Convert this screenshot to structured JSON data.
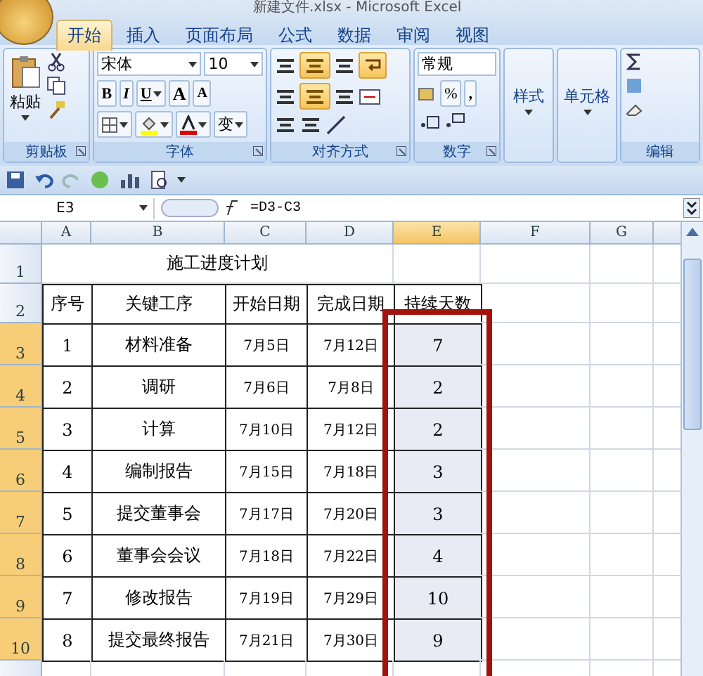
{
  "window": {
    "title": "新建文件.xlsx - Microsoft Excel"
  },
  "tabs": [
    {
      "label": "开始",
      "selected": true
    },
    {
      "label": "插入",
      "selected": false
    },
    {
      "label": "页面布局",
      "selected": false
    },
    {
      "label": "公式",
      "selected": false
    },
    {
      "label": "数据",
      "selected": false
    },
    {
      "label": "审阅",
      "selected": false
    },
    {
      "label": "视图",
      "selected": false
    }
  ],
  "ribbon": {
    "clipboard": {
      "paste": "粘贴",
      "label": "剪贴板"
    },
    "font": {
      "name": "宋体",
      "size": "10",
      "bold": "B",
      "italic": "I",
      "underline": "U",
      "grow": "A",
      "shrink": "A",
      "phonetic": "变",
      "label": "字体"
    },
    "alignment": {
      "label": "对齐方式"
    },
    "number": {
      "format": "常规",
      "percent": "%",
      "comma": ",",
      "label": "数字"
    },
    "styles": {
      "label": "样式"
    },
    "cells": {
      "label": "单元格"
    },
    "editing": {
      "label": "编辑"
    }
  },
  "formula_bar": {
    "name_box": "E3",
    "formula": "=D3-C3"
  },
  "sheet": {
    "columns": [
      {
        "label": "A",
        "selected": false
      },
      {
        "label": "B",
        "selected": false
      },
      {
        "label": "C",
        "selected": false
      },
      {
        "label": "D",
        "selected": false
      },
      {
        "label": "E",
        "selected": true
      },
      {
        "label": "F",
        "selected": false
      },
      {
        "label": "G",
        "selected": false
      }
    ],
    "rows": [
      {
        "number": "1",
        "kind": "title",
        "selected": false,
        "cells": [
          "施工进度计划"
        ]
      },
      {
        "number": "2",
        "kind": "header",
        "selected": false,
        "cells": [
          "序号",
          "关键工序",
          "开始日期",
          "完成日期",
          "持续天数"
        ]
      },
      {
        "number": "3",
        "kind": "data",
        "selected": true,
        "cells": [
          "1",
          "材料准备",
          "7月5日",
          "7月12日",
          "7"
        ]
      },
      {
        "number": "4",
        "kind": "data",
        "selected": true,
        "cells": [
          "2",
          "调研",
          "7月6日",
          "7月8日",
          "2"
        ]
      },
      {
        "number": "5",
        "kind": "data",
        "selected": true,
        "cells": [
          "3",
          "计算",
          "7月10日",
          "7月12日",
          "2"
        ]
      },
      {
        "number": "6",
        "kind": "data",
        "selected": true,
        "cells": [
          "4",
          "编制报告",
          "7月15日",
          "7月18日",
          "3"
        ]
      },
      {
        "number": "7",
        "kind": "data",
        "selected": true,
        "cells": [
          "5",
          "提交董事会",
          "7月17日",
          "7月20日",
          "3"
        ]
      },
      {
        "number": "8",
        "kind": "data",
        "selected": true,
        "cells": [
          "6",
          "董事会会议",
          "7月18日",
          "7月22日",
          "4"
        ]
      },
      {
        "number": "9",
        "kind": "data",
        "selected": true,
        "cells": [
          "7",
          "修改报告",
          "7月19日",
          "7月29日",
          "10"
        ]
      },
      {
        "number": "10",
        "kind": "data",
        "selected": true,
        "cells": [
          "8",
          "提交最终报告",
          "7月21日",
          "7月30日",
          "9"
        ]
      }
    ]
  }
}
